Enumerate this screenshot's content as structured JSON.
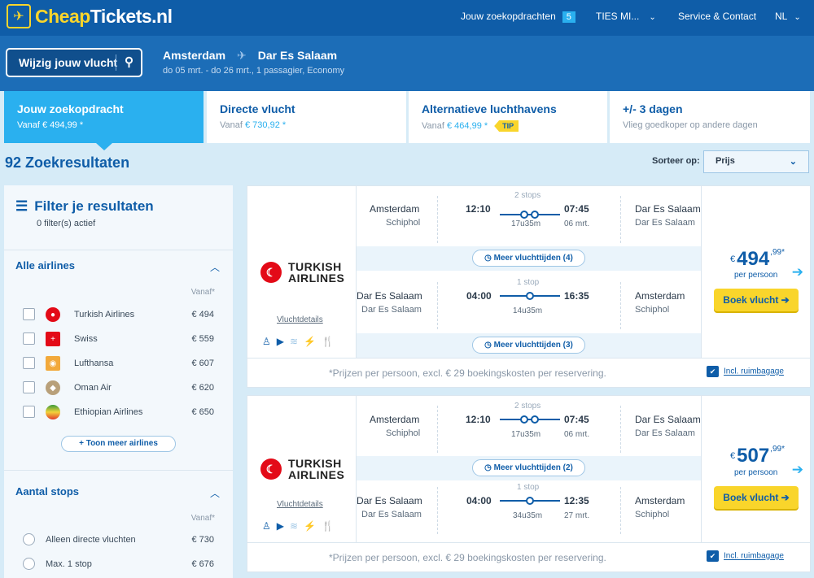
{
  "nav": {
    "logo_part1": "Cheap",
    "logo_part2": "Tickets.nl",
    "logo_icon": "plane-icon",
    "searches_label": "Jouw zoekopdrachten",
    "searches_count": "5",
    "user_label": "TIES MI...",
    "service_label": "Service & Contact",
    "language": "NL"
  },
  "search": {
    "edit_label": "Wijzig jouw vlucht",
    "origin": "Amsterdam",
    "destination": "Dar Es Salaam",
    "details": "do 05 mrt. - do 26 mrt., 1 passagier, Economy"
  },
  "tabs": [
    {
      "title": "Jouw zoekopdracht",
      "subtitle": "Vanaf € 494,99 *"
    },
    {
      "title": "Directe vlucht",
      "subtitle_prefix": "Vanaf",
      "subtitle_price": "€ 730,92 *"
    },
    {
      "title": "Alternatieve luchthavens",
      "subtitle_prefix": "Vanaf",
      "subtitle_price": "€ 464,99 *",
      "tip": "TIP"
    },
    {
      "title": "+/- 3 dagen",
      "subtitle": "Vlieg goedkoper op andere dagen"
    }
  ],
  "results": {
    "count_label": "92 Zoekresultaten",
    "sort_label": "Sorteer op:",
    "sort_value": "Prijs"
  },
  "filter": {
    "title": "Filter je resultaten",
    "active": "0 filter(s) actief",
    "airlines_title": "Alle airlines",
    "vanaf_label": "Vanaf",
    "airlines": [
      {
        "name": "Turkish Airlines",
        "price": "€ 494",
        "color": "#e30a17"
      },
      {
        "name": "Swiss",
        "price": "€ 559",
        "color": "#e30a17"
      },
      {
        "name": "Lufthansa",
        "price": "€ 607",
        "color": "#f2a93b"
      },
      {
        "name": "Oman Air",
        "price": "€ 620",
        "color": "#b8a07a"
      },
      {
        "name": "Ethiopian Airlines",
        "price": "€ 650",
        "color": "#3a9b3a"
      }
    ],
    "more_airlines": "+ Toon meer airlines",
    "stops_title": "Aantal stops",
    "stops": [
      {
        "name": "Alleen directe vluchten",
        "price": "€ 730"
      },
      {
        "name": "Max. 1 stop",
        "price": "€ 676"
      }
    ]
  },
  "cards": [
    {
      "airline_line1": "TURKISH",
      "airline_line2": "AIRLINES",
      "details_link": "Vluchtdetails",
      "out": {
        "from_city": "Amsterdam",
        "from_apt": "Schiphol",
        "dep": "12:10",
        "stops": "2 stops",
        "duration": "17u35m",
        "arr": "07:45",
        "date": "06 mrt.",
        "to_city": "Dar Es Salaam",
        "to_apt": "Dar Es Salaam"
      },
      "out_more": "Meer vluchttijden (4)",
      "ret": {
        "from_city": "Dar Es Salaam",
        "from_apt": "Dar Es Salaam",
        "dep": "04:00",
        "stops": "1 stop",
        "duration": "14u35m",
        "arr": "16:35",
        "date": "",
        "to_city": "Amsterdam",
        "to_apt": "Schiphol"
      },
      "ret_more": "Meer vluchttijden (3)",
      "price_currency": "€",
      "price_main": "494",
      "price_cents": ",99*",
      "per_person": "per persoon",
      "book_label": "Boek vlucht ➔",
      "footnote": "*Prijzen per persoon, excl. € 29 boekingskosten per reservering.",
      "baggage": "Incl. ruimbagage"
    },
    {
      "airline_line1": "TURKISH",
      "airline_line2": "AIRLINES",
      "details_link": "Vluchtdetails",
      "out": {
        "from_city": "Amsterdam",
        "from_apt": "Schiphol",
        "dep": "12:10",
        "stops": "2 stops",
        "duration": "17u35m",
        "arr": "07:45",
        "date": "06 mrt.",
        "to_city": "Dar Es Salaam",
        "to_apt": "Dar Es Salaam"
      },
      "out_more": "Meer vluchttijden (2)",
      "ret": {
        "from_city": "Dar Es Salaam",
        "from_apt": "Dar Es Salaam",
        "dep": "04:00",
        "stops": "1 stop",
        "duration": "34u35m",
        "arr": "12:35",
        "date": "27 mrt.",
        "to_city": "Amsterdam",
        "to_apt": "Schiphol"
      },
      "ret_more": "",
      "price_currency": "€",
      "price_main": "507",
      "price_cents": ",99*",
      "per_person": "per persoon",
      "book_label": "Boek vlucht ➔",
      "footnote": "*Prijzen per persoon, excl. € 29 boekingskosten per reservering.",
      "baggage": "Incl. ruimbagage"
    }
  ],
  "colors": {
    "nav": "#0f5da8",
    "accent": "#2ab0ef",
    "cta": "#f9d52b"
  }
}
